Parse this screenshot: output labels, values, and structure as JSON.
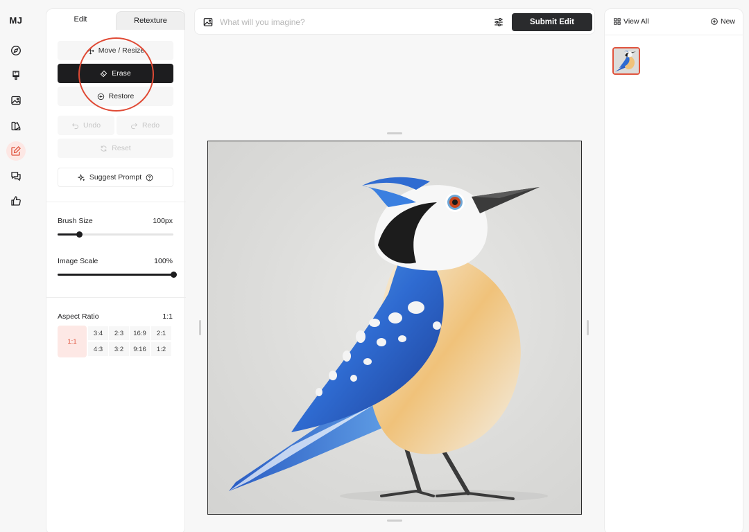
{
  "app": {
    "logo": "MJ"
  },
  "rail": {
    "items": [
      {
        "icon": "compass-icon",
        "active": false
      },
      {
        "icon": "paintbrush-icon",
        "active": false
      },
      {
        "icon": "image-icon",
        "active": false
      },
      {
        "icon": "palette-icon",
        "active": false
      },
      {
        "icon": "edit-icon",
        "active": true
      },
      {
        "icon": "chat-icon",
        "active": false
      },
      {
        "icon": "thumbs-up-icon",
        "active": false
      }
    ]
  },
  "tabs": {
    "edit": "Edit",
    "retexture": "Retexture"
  },
  "tools": {
    "move_resize": "Move / Resize",
    "erase": "Erase",
    "restore": "Restore",
    "undo": "Undo",
    "redo": "Redo",
    "reset": "Reset",
    "suggest_prompt": "Suggest Prompt",
    "selected": "Erase"
  },
  "brush": {
    "label": "Brush Size",
    "value_text": "100px",
    "fraction": 0.19
  },
  "image_scale": {
    "label": "Image Scale",
    "value_text": "100%",
    "fraction": 1.0
  },
  "aspect": {
    "label": "Aspect Ratio",
    "current": "1:1",
    "selected": "1:1",
    "options_row1": [
      "3:4",
      "2:3",
      "16:9",
      "2:1"
    ],
    "options_row2": [
      "4:3",
      "3:2",
      "9:16",
      "1:2"
    ]
  },
  "prompt": {
    "placeholder": "What will you imagine?",
    "value": "",
    "submit_label": "Submit Edit"
  },
  "right_panel": {
    "view_all": "View All",
    "new": "New"
  },
  "colors": {
    "accent": "#e0533d",
    "dark": "#1d1d1f",
    "selected_bg": "#fde8e5"
  }
}
